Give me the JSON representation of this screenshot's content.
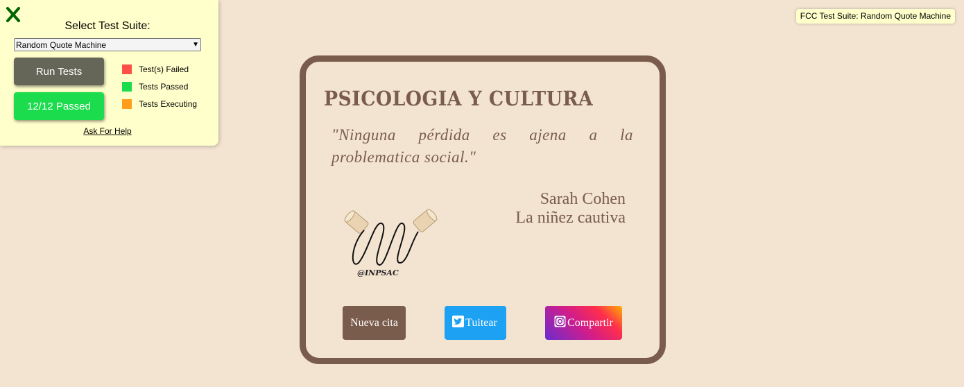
{
  "test_panel": {
    "title": "Select Test Suite:",
    "selected_suite": "Random Quote Machine",
    "run_button": "Run Tests",
    "passed_button": "12/12 Passed",
    "legend": [
      {
        "label": "Test(s) Failed",
        "color": "#ff4f46"
      },
      {
        "label": "Tests Passed",
        "color": "#1bdc4c"
      },
      {
        "label": "Tests Executing",
        "color": "#ff9e1d"
      }
    ],
    "help_link": "Ask For Help",
    "close_icon": "close-x-icon",
    "close_color": "#006400"
  },
  "suite_tag": "FCC Test Suite: Random Quote Machine",
  "card": {
    "title": "PSICOLOGIA Y CULTURA",
    "quote": "\"Ninguna pérdida es ajena a la problematica social.\"",
    "author": "Sarah Cohen",
    "source": "La niñez cautiva",
    "logo_text": "@INPSAC",
    "buttons": {
      "new_quote": "Nueva cita",
      "tweet": "Tuitear",
      "share": "Compartir"
    },
    "colors": {
      "accent": "#7a5c4d",
      "background": "#f3e3d1",
      "twitter": "#1da1f2"
    }
  }
}
